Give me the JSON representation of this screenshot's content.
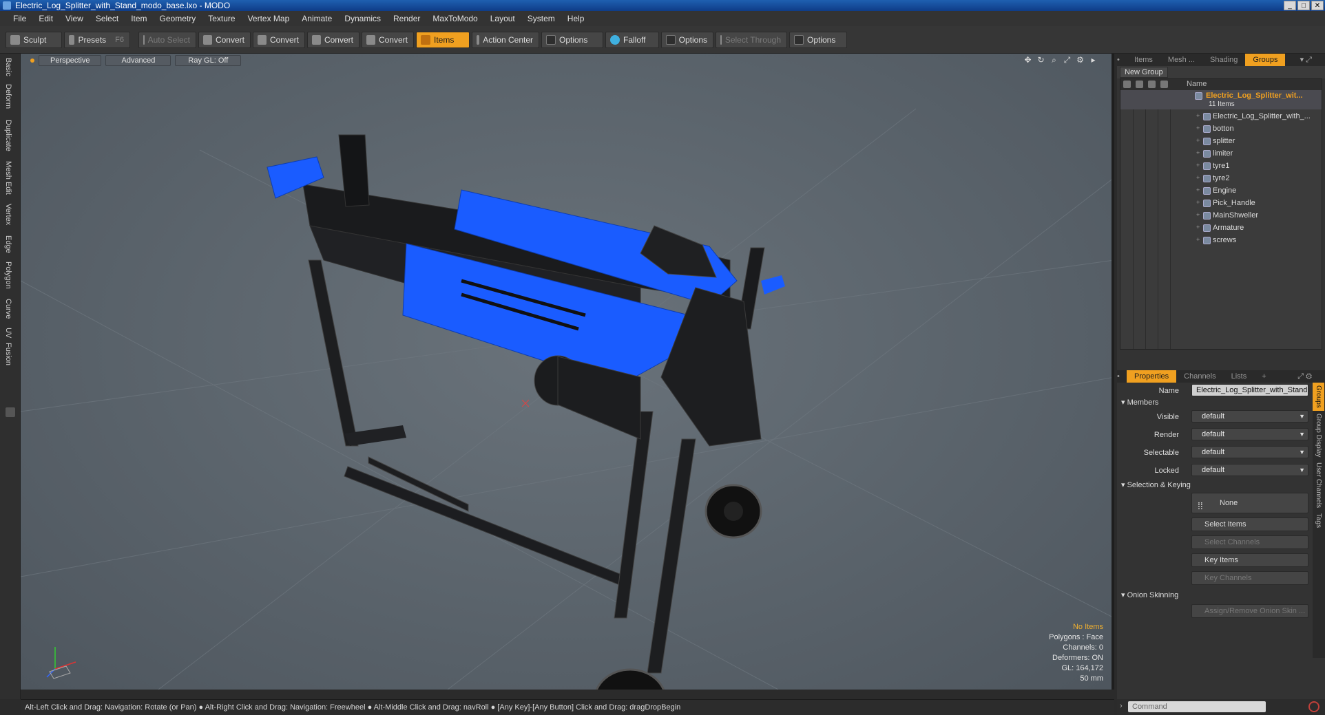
{
  "window": {
    "title": "Electric_Log_Splitter_with_Stand_modo_base.lxo - MODO"
  },
  "menu": [
    "File",
    "Edit",
    "View",
    "Select",
    "Item",
    "Geometry",
    "Texture",
    "Vertex Map",
    "Animate",
    "Dynamics",
    "Render",
    "MaxToModo",
    "Layout",
    "System",
    "Help"
  ],
  "toolbar": {
    "sculpt": "Sculpt",
    "presets": "Presets",
    "presets_key": "F6",
    "auto_select": "Auto Select",
    "convert1": "Convert",
    "convert2": "Convert",
    "convert3": "Convert",
    "convert4": "Convert",
    "items": "Items",
    "action_center": "Action Center",
    "options1": "Options",
    "falloff": "Falloff",
    "options2": "Options",
    "select_through": "Select Through",
    "options3": "Options"
  },
  "left_tabs": [
    "Basic",
    "Deform",
    "Duplicate",
    "Mesh Edit",
    "Vertex",
    "Edge",
    "Polygon",
    "Curve",
    "UV",
    "Fusion"
  ],
  "viewport": {
    "view_mode": "Perspective",
    "shading": "Advanced",
    "raygl": "Ray GL: Off",
    "stats": {
      "selection": "No Items",
      "polygons": "Polygons : Face",
      "channels": "Channels: 0",
      "deformers": "Deformers: ON",
      "gl": "GL: 164,172",
      "scale": "50 mm"
    }
  },
  "status_bar": "Alt-Left Click and Drag: Navigation: Rotate (or Pan) ● Alt-Right Click and Drag: Navigation: Freewheel ● Alt-Middle Click and Drag: navRoll ● [Any Key]-[Any Button] Click and Drag: dragDropBegin",
  "right_panel": {
    "top_tabs": [
      "Items",
      "Mesh ...",
      "Shading",
      "Groups"
    ],
    "active_top_tab": "Groups",
    "new_group": "New Group",
    "tree_header": "Name",
    "group_name": "Electric_Log_Splitter_wit...",
    "group_count": "11 Items",
    "group_items": [
      "Electric_Log_Splitter_with_...",
      "botton",
      "splitter",
      "limiter",
      "tyre1",
      "tyre2",
      "Engine",
      "Pick_Handle",
      "MainShweller",
      "Armature",
      "screws"
    ],
    "bottom_tabs": [
      "Properties",
      "Channels",
      "Lists",
      "+"
    ],
    "props": {
      "name_label": "Name",
      "name_value": "Electric_Log_Splitter_with_Stand",
      "members": "Members",
      "visible_label": "Visible",
      "visible_value": "default",
      "render_label": "Render",
      "render_value": "default",
      "selectable_label": "Selectable",
      "selectable_value": "default",
      "locked_label": "Locked",
      "locked_value": "default",
      "selection_keying": "Selection & Keying",
      "none": "None",
      "select_items": "Select Items",
      "select_channels": "Select Channels",
      "key_items": "Key Items",
      "key_channels": "Key Channels",
      "onion_skinning": "Onion Skinning",
      "assign_onion": "Assign/Remove Onion Skin ..."
    },
    "side_tabs": [
      "Groups",
      "Group Display",
      "User Channels",
      "Tags"
    ],
    "command_placeholder": "Command"
  },
  "colors": {
    "accent": "#f0a020",
    "model_blue": "#1a5cff",
    "title_blue": "#1f5fb0"
  }
}
